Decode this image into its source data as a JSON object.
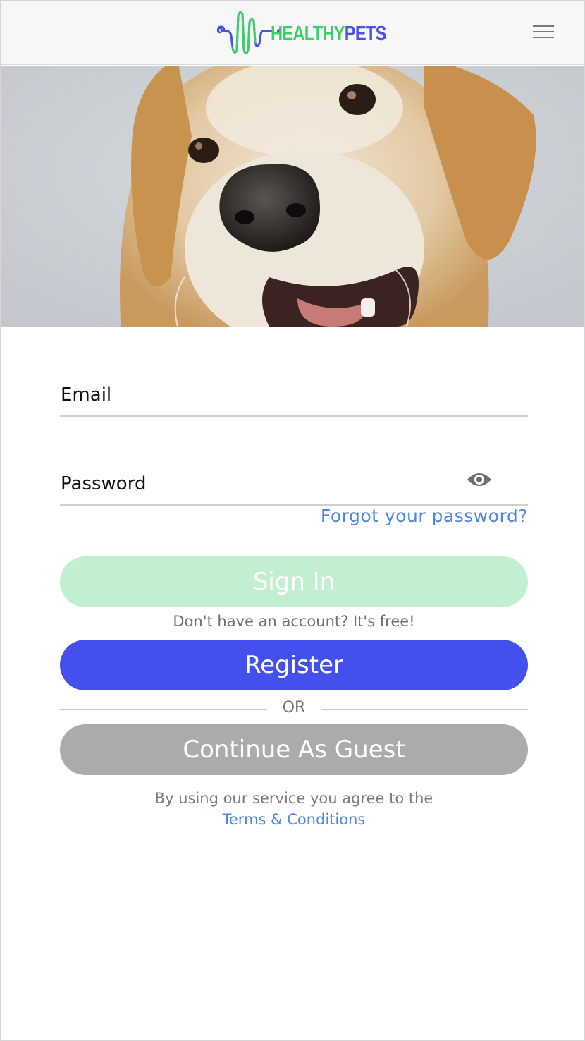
{
  "header": {
    "logo_text_1": "HEALTHY",
    "logo_text_2": "PETS",
    "menu_icon": "hamburger-menu-icon"
  },
  "hero": {
    "subject": "dog photo"
  },
  "form": {
    "email_placeholder": "Email",
    "email_value": "",
    "password_placeholder": "Password",
    "password_value": "",
    "password_toggle_icon": "eye-icon",
    "forgot_label": "Forgot your password?",
    "signin_label": "Sign In",
    "no_account_text": "Don't have an account? It's free!",
    "register_label": "Register",
    "or_text": "OR",
    "guest_label": "Continue As Guest"
  },
  "legal": {
    "line1": "By using our service you agree to the",
    "terms_label": "Terms & Conditions"
  },
  "colors": {
    "brand_green": "#3ecf6a",
    "brand_blue": "#4350ee",
    "link_blue": "#4e86e0",
    "signin_disabled": "#c1efcf",
    "guest_gray": "#ababab"
  }
}
